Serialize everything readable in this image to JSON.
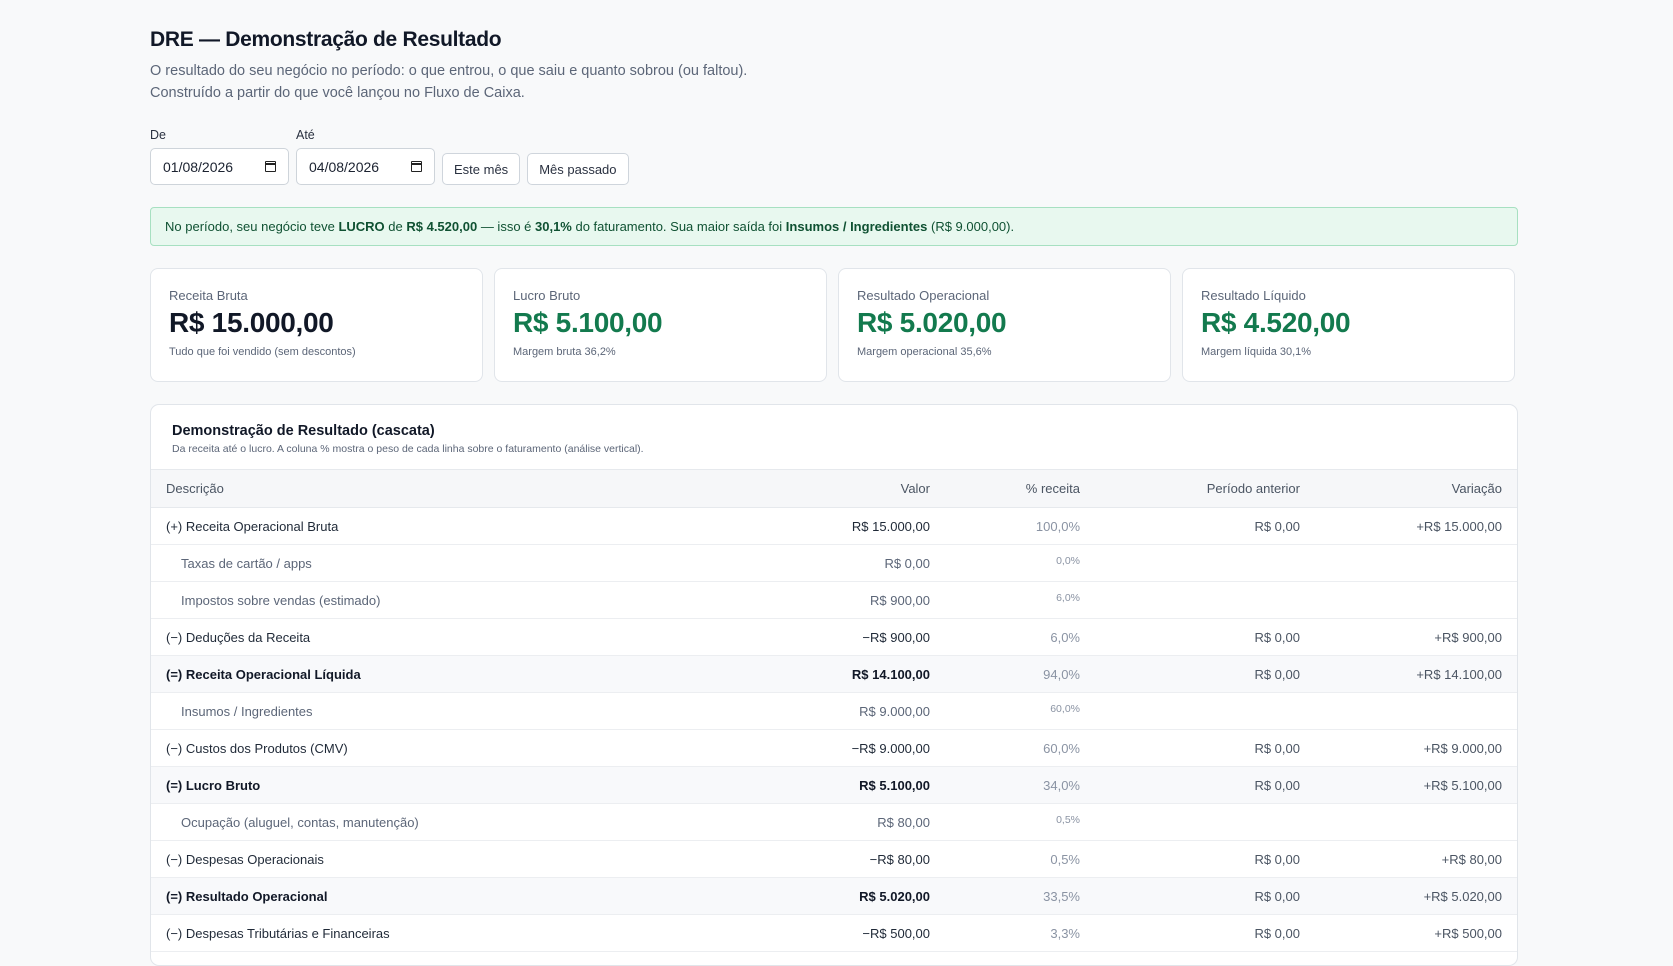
{
  "header": {
    "title": "DRE — Demonstração de Resultado",
    "subtitle": "O resultado do seu negócio no período: o que entrou, o que saiu e quanto sobrou (ou faltou). Construído a partir do que você lançou no Fluxo de Caixa."
  },
  "filters": {
    "from_label": "De",
    "from_value": "01/08/2026",
    "to_label": "Até",
    "to_value": "04/08/2026",
    "this_month_label": "Este mês",
    "last_month_label": "Mês passado"
  },
  "alert": {
    "t1": "No período, seu negócio teve ",
    "b1": "LUCRO",
    "t2": " de ",
    "b2": "R$ 4.520,00",
    "t3": " — isso é ",
    "b3": "30,1%",
    "t4": " do faturamento. Sua maior saída foi ",
    "b4": "Insumos / Ingredientes",
    "t5": " (R$ 9.000,00)."
  },
  "cards": [
    {
      "label": "Receita Bruta",
      "value": "R$ 15.000,00",
      "note": "Tudo que foi vendido (sem descontos)"
    },
    {
      "label": "Lucro Bruto",
      "value": "R$ 5.100,00",
      "note": "Margem bruta 36,2%"
    },
    {
      "label": "Resultado Operacional",
      "value": "R$ 5.020,00",
      "note": "Margem operacional 35,6%"
    },
    {
      "label": "Resultado Líquido",
      "value": "R$ 4.520,00",
      "note": "Margem líquida 30,1%"
    }
  ],
  "colors": {
    "positive": "#137a4e",
    "alert_bg": "#e8f8ef"
  },
  "table": {
    "title": "Demonstração de Resultado (cascata)",
    "subtitle": "Da receita até o lucro. A coluna % mostra o peso de cada linha sobre o faturamento (análise vertical).",
    "columns": [
      "Descrição",
      "Valor",
      "% receita",
      "Período anterior",
      "Variação"
    ],
    "rows": [
      {
        "desc": "(+) Receita Operacional Bruta",
        "value": "R$ 15.000,00",
        "pct": "100,0%",
        "prev": "R$ 0,00",
        "var": "+R$ 15.000,00"
      },
      {
        "desc": "Taxas de cartão / apps",
        "value": "R$ 0,00",
        "pct": "0,0%",
        "prev": "",
        "var": ""
      },
      {
        "desc": "Impostos sobre vendas (estimado)",
        "value": "R$ 900,00",
        "pct": "6,0%",
        "prev": "",
        "var": ""
      },
      {
        "desc": "(−) Deduções da Receita",
        "value": "−R$ 900,00",
        "pct": "6,0%",
        "prev": "R$ 0,00",
        "var": "+R$ 900,00"
      },
      {
        "desc": "(=) Receita Operacional Líquida",
        "value": "R$ 14.100,00",
        "pct": "94,0%",
        "prev": "R$ 0,00",
        "var": "+R$ 14.100,00"
      },
      {
        "desc": "Insumos / Ingredientes",
        "value": "R$ 9.000,00",
        "pct": "60,0%",
        "prev": "",
        "var": ""
      },
      {
        "desc": "(−) Custos dos Produtos (CMV)",
        "value": "−R$ 9.000,00",
        "pct": "60,0%",
        "prev": "R$ 0,00",
        "var": "+R$ 9.000,00"
      },
      {
        "desc": "(=) Lucro Bruto",
        "value": "R$ 5.100,00",
        "pct": "34,0%",
        "prev": "R$ 0,00",
        "var": "+R$ 5.100,00"
      },
      {
        "desc": "Ocupação (aluguel, contas, manutenção)",
        "value": "R$ 80,00",
        "pct": "0,5%",
        "prev": "",
        "var": ""
      },
      {
        "desc": "(−) Despesas Operacionais",
        "value": "−R$ 80,00",
        "pct": "0,5%",
        "prev": "R$ 0,00",
        "var": "+R$ 80,00"
      },
      {
        "desc": "(=) Resultado Operacional",
        "value": "R$ 5.020,00",
        "pct": "33,5%",
        "prev": "R$ 0,00",
        "var": "+R$ 5.020,00"
      },
      {
        "desc": "(−) Despesas Tributárias e Financeiras",
        "value": "−R$ 500,00",
        "pct": "3,3%",
        "prev": "R$ 0,00",
        "var": "+R$ 500,00"
      }
    ]
  }
}
